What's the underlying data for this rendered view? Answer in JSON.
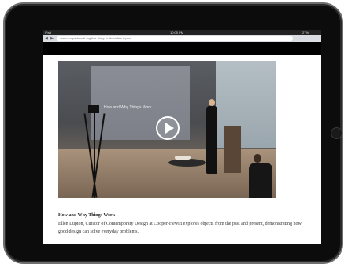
{
  "device": {
    "statusbar": {
      "carrier": "iPad",
      "time": "10:05 PM",
      "battery": "27%"
    },
    "browser": {
      "url": "www.cooperhewitt.org/this-thing-or-that/ellen-lupton",
      "back_icon": "back-arrow-icon",
      "forward_icon": "forward-arrow-icon"
    }
  },
  "video": {
    "slide_text": "How and Why Things Work",
    "play_icon": "play-icon"
  },
  "caption": {
    "title": "How and Why Things Work",
    "description": "Ellen Lupton, Curator of Contemporary Design at Cooper-Hewitt explores objects from the past and present, demonstrating how good design can solve everyday problems."
  },
  "colors": {
    "bezel": "#0c0c0c",
    "screen_bg": "#ffffff",
    "title_text": "#222222"
  }
}
